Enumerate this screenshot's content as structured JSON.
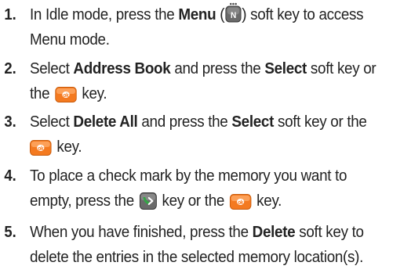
{
  "steps": [
    {
      "number": "1.",
      "parts": [
        "In Idle mode, press the ",
        "Menu",
        " (",
        ") soft key to access",
        "Menu mode."
      ]
    },
    {
      "number": "2.",
      "parts": [
        "Select ",
        "Address Book",
        " and press the ",
        "Select",
        " soft key or",
        "the ",
        " key."
      ]
    },
    {
      "number": "3.",
      "parts": [
        "Select ",
        "Delete All",
        " and press the ",
        "Select",
        " soft key or the",
        " key."
      ]
    },
    {
      "number": "4.",
      "parts": [
        "To place a check mark by the memory you want to",
        "empty, press the ",
        " key or the ",
        " key."
      ]
    },
    {
      "number": "5.",
      "parts": [
        "When you have finished, press the ",
        "Delete",
        " soft key to",
        "delete the entries in the selected memory location(s)."
      ]
    }
  ],
  "colors": {
    "text": "#222222",
    "ok_key": "#f47a20",
    "menu_key": "#555555",
    "send_key_green": "#33a545"
  },
  "icons": {
    "menu_key": "menu-soft-key-icon",
    "ok_key": "ok-key-icon",
    "send_key": "send-key-icon"
  }
}
